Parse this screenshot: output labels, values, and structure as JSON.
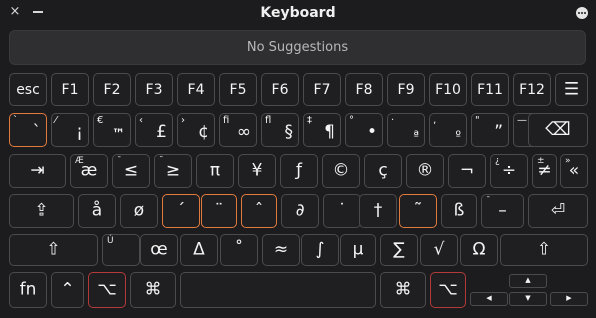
{
  "window": {
    "title": "Keyboard",
    "close_glyph": "×"
  },
  "suggestions": {
    "text": "No Suggestions"
  },
  "row1": [
    {
      "label": "esc",
      "name": "key-esc"
    },
    {
      "label": "F1",
      "name": "key-f1"
    },
    {
      "label": "F2",
      "name": "key-f2"
    },
    {
      "label": "F3",
      "name": "key-f3"
    },
    {
      "label": "F4",
      "name": "key-f4"
    },
    {
      "label": "F5",
      "name": "key-f5"
    },
    {
      "label": "F6",
      "name": "key-f6"
    },
    {
      "label": "F7",
      "name": "key-f7"
    },
    {
      "label": "F8",
      "name": "key-f8"
    },
    {
      "label": "F9",
      "name": "key-f9"
    },
    {
      "label": "F10",
      "name": "key-f10"
    },
    {
      "label": "F11",
      "name": "key-f11"
    },
    {
      "label": "F12",
      "name": "key-f12"
    }
  ],
  "row2": [
    {
      "sup": "`",
      "main": "`",
      "name": "key-backtick"
    },
    {
      "sup": "⁄",
      "main": "¡",
      "name": "key-1"
    },
    {
      "sup": "€",
      "main": "™",
      "name": "key-2"
    },
    {
      "sup": "‹",
      "main": "£",
      "name": "key-3"
    },
    {
      "sup": "›",
      "main": "¢",
      "name": "key-4"
    },
    {
      "sup": "fi",
      "main": "∞",
      "name": "key-5"
    },
    {
      "sup": "fl",
      "main": "§",
      "name": "key-6"
    },
    {
      "sup": "‡",
      "main": "¶",
      "name": "key-7"
    },
    {
      "sup": "°",
      "main": "•",
      "name": "key-8"
    },
    {
      "sup": "·",
      "main": "ª",
      "name": "key-9"
    },
    {
      "sup": "‚",
      "main": "º",
      "name": "key-0"
    },
    {
      "sup": "—",
      "main": "–",
      "name": "key-minus"
    },
    {
      "sup": "±",
      "main": "≠",
      "name": "key-equals"
    }
  ],
  "row3": [
    {
      "main": "å",
      "name": "key-a"
    },
    {
      "main": "ß",
      "name": "key-s"
    },
    {
      "main": "∂",
      "name": "key-d"
    },
    {
      "main": "ƒ",
      "name": "key-f"
    },
    {
      "main": "©",
      "name": "key-g"
    },
    {
      "main": "˙",
      "name": "key-h"
    },
    {
      "main": "∆",
      "name": "key-j"
    },
    {
      "main": "˚",
      "name": "key-k"
    },
    {
      "main": "¬",
      "name": "key-l"
    },
    {
      "main": "…",
      "name": "key-semicolon"
    },
    {
      "main": "æ",
      "name": "key-quote"
    }
  ],
  "keys": {
    "tab_glyph": "⇥",
    "ae_sup": "Æ",
    "ae": "æ",
    "le_sup": "¯",
    "le": "≤",
    "ge_sup": "˘",
    "ge": "≥",
    "pi": "π",
    "yen": "¥",
    "f": "ƒ",
    "copy": "©",
    "cc": "ç",
    "reg": "®",
    "not": "¬",
    "div_sup": "¿",
    "div": "÷",
    "neq_sup": "±",
    "neq": "≠",
    "laquo_sup": "»",
    "laquo": "«",
    "delete_glyph": "⌫",
    "caps_glyph": "⇪",
    "aring": "å",
    "oslash": "ø",
    "acute": "´",
    "umlaut": "¨",
    "circ": "ˆ",
    "partial": "∂",
    "dot": "˙",
    "dagger": "†",
    "tilde": "˜",
    "sz": "ß",
    "dash_sup": "¯",
    "dash": "–",
    "return_glyph": "⏎",
    "shift_glyph": "⇧",
    "oe_sup": "Ú",
    "oe": "œ",
    "delta": "Δ",
    "ring": "˚",
    "approx": "≈",
    "integral": "∫",
    "mu": "µ",
    "sigma": "∑",
    "sqrt": "√",
    "omega": "Ω",
    "fn": "fn",
    "ctrl_glyph": "⌃",
    "opt_glyph": "⌥",
    "cmd_glyph": "⌘",
    "list_glyph": "☰",
    "up": "▲",
    "down": "▼",
    "left": "◀",
    "right": "▶",
    "row2_tail_sup": "\"",
    "row2_tail": "”"
  }
}
